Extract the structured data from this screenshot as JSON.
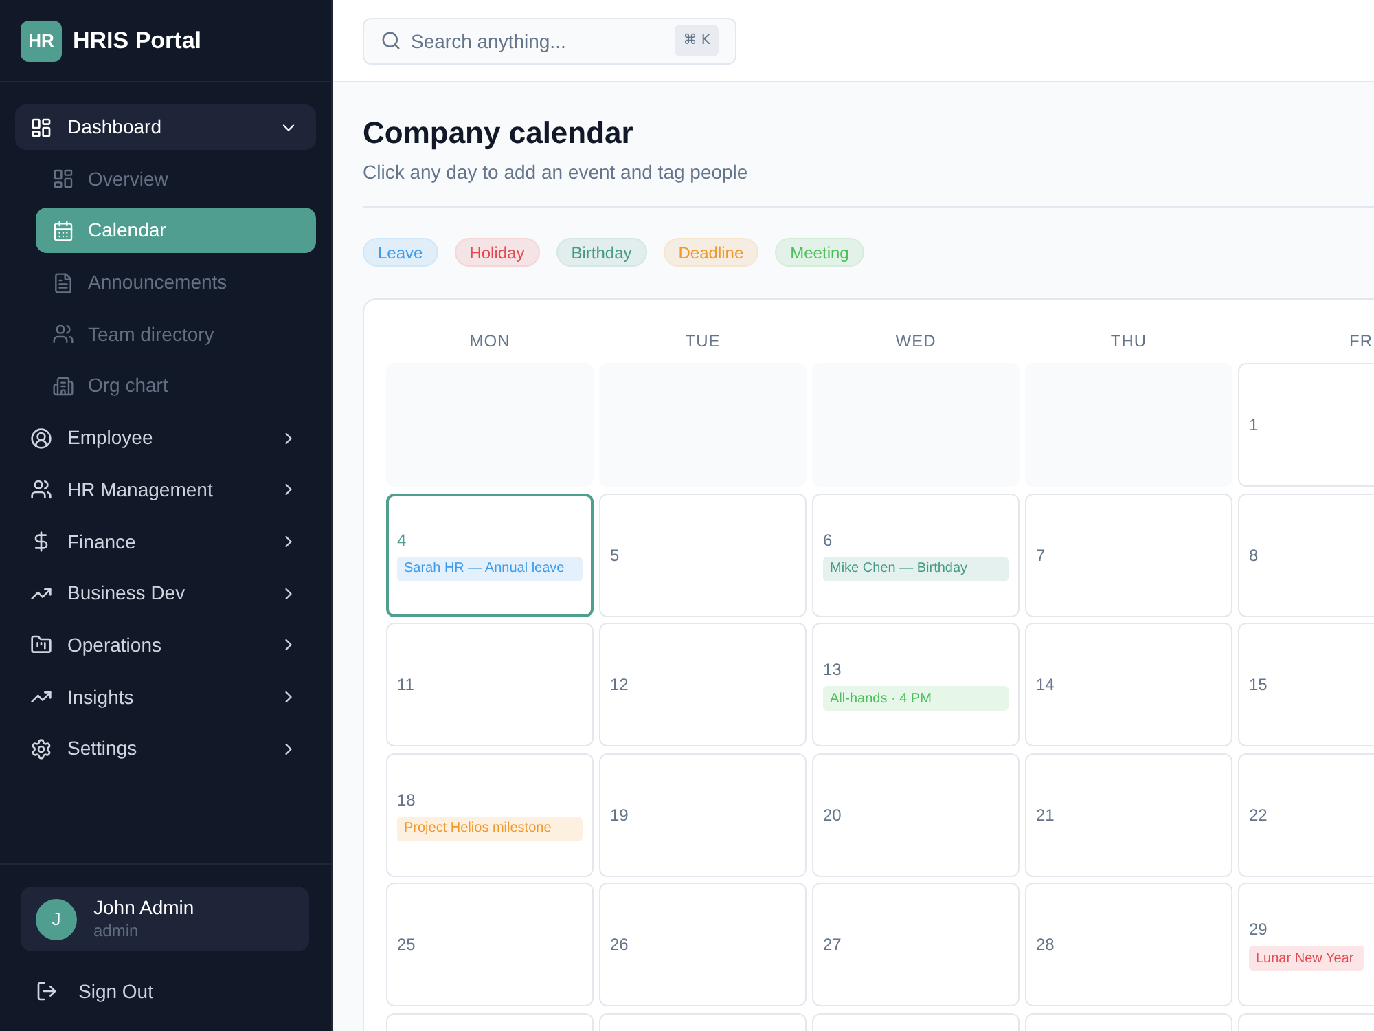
{
  "sidebar": {
    "brand": {
      "logo": "HR",
      "title": "HRIS Portal"
    },
    "nav": [
      {
        "label": "Dashboard",
        "expanded": true,
        "children": [
          {
            "label": "Overview",
            "selected": false
          },
          {
            "label": "Calendar",
            "selected": true
          },
          {
            "label": "Announcements",
            "selected": false
          },
          {
            "label": "Team directory",
            "selected": false
          },
          {
            "label": "Org chart",
            "selected": false
          }
        ]
      },
      {
        "label": "Employee",
        "expanded": false
      },
      {
        "label": "HR Management",
        "expanded": false
      },
      {
        "label": "Finance",
        "expanded": false
      },
      {
        "label": "Business Dev",
        "expanded": false
      },
      {
        "label": "Operations",
        "expanded": false
      },
      {
        "label": "Insights",
        "expanded": false
      },
      {
        "label": "Settings",
        "expanded": false
      }
    ],
    "user": {
      "initial": "J",
      "name": "John Admin",
      "role": "admin"
    },
    "sign_out": "Sign Out"
  },
  "search": {
    "placeholder": "Search anything...",
    "shortcut": "⌘ K"
  },
  "page": {
    "title": "Company calendar",
    "subtitle": "Click any day to add an event and tag people"
  },
  "legend": [
    {
      "label": "Leave",
      "color": "#3d9be9"
    },
    {
      "label": "Holiday",
      "color": "#e5484d"
    },
    {
      "label": "Birthday",
      "color": "#459a86"
    },
    {
      "label": "Deadline",
      "color": "#f0982a"
    },
    {
      "label": "Meeting",
      "color": "#4cbf5a"
    }
  ],
  "calendar": {
    "weekdays": [
      "MON",
      "TUE",
      "WED",
      "THU",
      "FR"
    ],
    "weeks": [
      [
        {
          "kind": "blank"
        },
        {
          "kind": "blank"
        },
        {
          "kind": "blank"
        },
        {
          "kind": "blank"
        },
        {
          "kind": "day",
          "day": "1",
          "selected": false
        }
      ],
      [
        {
          "kind": "day",
          "day": "4",
          "selected": true,
          "events": [
            {
              "label": "Sarah HR — Annual leave",
              "color": "#3d9be9"
            }
          ]
        },
        {
          "kind": "day",
          "day": "5",
          "selected": false
        },
        {
          "kind": "day",
          "day": "6",
          "selected": false,
          "events": [
            {
              "label": "Mike Chen — Birthday",
              "color": "#459a86"
            }
          ]
        },
        {
          "kind": "day",
          "day": "7",
          "selected": false
        },
        {
          "kind": "day",
          "day": "8",
          "selected": false
        }
      ],
      [
        {
          "kind": "day",
          "day": "11",
          "selected": false
        },
        {
          "kind": "day",
          "day": "12",
          "selected": false
        },
        {
          "kind": "day",
          "day": "13",
          "selected": false,
          "events": [
            {
              "label": "All-hands · 4 PM",
              "color": "#4cbf5a"
            }
          ]
        },
        {
          "kind": "day",
          "day": "14",
          "selected": false
        },
        {
          "kind": "day",
          "day": "15",
          "selected": false
        }
      ],
      [
        {
          "kind": "day",
          "day": "18",
          "selected": false,
          "events": [
            {
              "label": "Project Helios milestone",
              "color": "#f0982a"
            }
          ]
        },
        {
          "kind": "day",
          "day": "19",
          "selected": false
        },
        {
          "kind": "day",
          "day": "20",
          "selected": false
        },
        {
          "kind": "day",
          "day": "21",
          "selected": false
        },
        {
          "kind": "day",
          "day": "22",
          "selected": false
        }
      ],
      [
        {
          "kind": "day",
          "day": "25",
          "selected": false
        },
        {
          "kind": "day",
          "day": "26",
          "selected": false
        },
        {
          "kind": "day",
          "day": "27",
          "selected": false
        },
        {
          "kind": "day",
          "day": "28",
          "selected": false
        },
        {
          "kind": "day",
          "day": "29",
          "selected": false,
          "events": [
            {
              "label": "Lunar New Year",
              "color": "#e5484d"
            }
          ]
        }
      ],
      [
        {
          "kind": "day",
          "selected": false
        },
        {
          "kind": "day",
          "selected": false
        },
        {
          "kind": "day",
          "selected": false
        },
        {
          "kind": "day",
          "selected": false
        },
        {
          "kind": "day",
          "selected": false
        }
      ]
    ]
  }
}
